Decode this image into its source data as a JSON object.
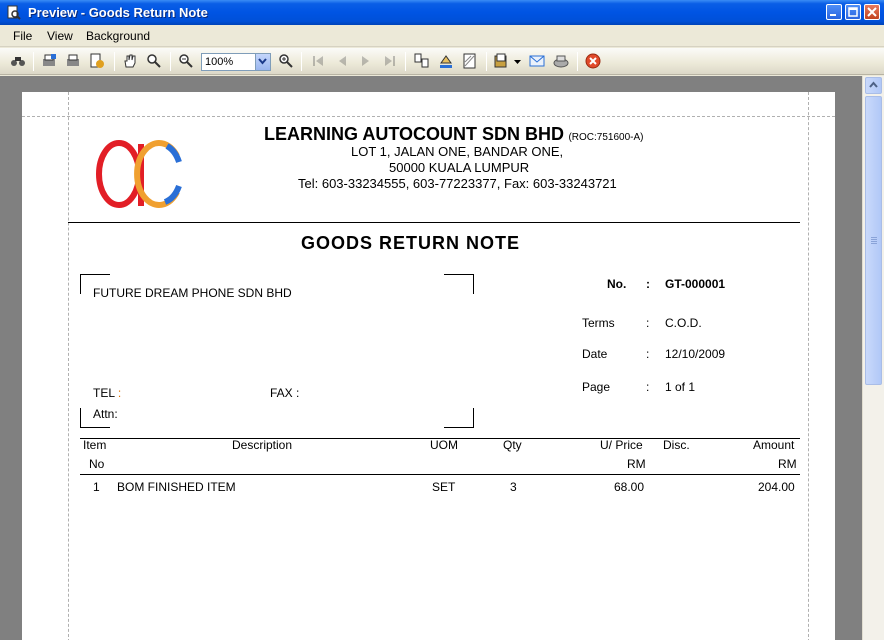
{
  "window": {
    "title": "Preview - Goods Return Note"
  },
  "menu": {
    "file": "File",
    "view": "View",
    "background": "Background"
  },
  "toolbar": {
    "zoom": "100%"
  },
  "company": {
    "name": "LEARNING AUTOCOUNT SDN BHD",
    "roc": "(ROC:751600-A)",
    "address1": "LOT 1, JALAN ONE,  BANDAR ONE,",
    "address2": "50000  KUALA LUMPUR",
    "contact": "Tel:  603-33234555,  603-77223377,   Fax: 603-33243721"
  },
  "document": {
    "title": "GOODS  RETURN  NOTE",
    "customer": "FUTURE DREAM PHONE SDN BHD",
    "tel_label": "TEL :",
    "fax_label": "FAX :",
    "attn_label": "Attn:",
    "no_label": "No.",
    "no_value": "GT-000001",
    "terms_label": "Terms",
    "terms_value": "C.O.D.",
    "date_label": "Date",
    "date_value": "12/10/2009",
    "page_label": "Page",
    "page_value": "1 of 1",
    "colon": ":"
  },
  "table": {
    "headers": {
      "item": "Item",
      "item2": "No",
      "description": "Description",
      "uom": "UOM",
      "qty": "Qty",
      "price": "U/ Price",
      "price2": "RM",
      "disc": "Disc.",
      "amount": "Amount",
      "amount2": "RM"
    },
    "rows": [
      {
        "no": "1",
        "description": "BOM FINISHED ITEM",
        "uom": "SET",
        "qty": "3",
        "price": "68.00",
        "disc": "",
        "amount": "204.00"
      }
    ]
  },
  "colors": {
    "logo_red": "#e21e26",
    "logo_orange": "#f0a030",
    "logo_blue": "#2a6fd6",
    "titlebar": "#0054e3"
  }
}
